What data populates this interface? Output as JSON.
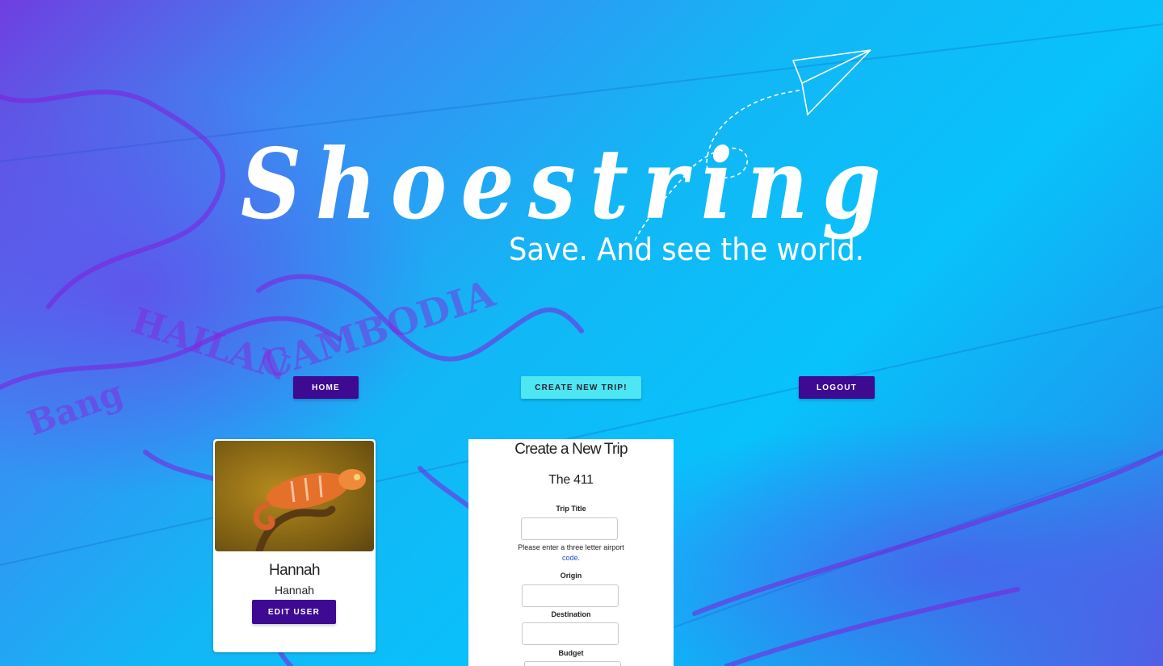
{
  "brand": {
    "name": "Shoestring",
    "tagline": "Save. And see the world."
  },
  "nav": {
    "home": "HOME",
    "create_trip": "CREATE NEW TRIP!",
    "logout": "LOGOUT"
  },
  "user_card": {
    "display_name": "Hannah",
    "username": "Hannah",
    "edit_label": "EDIT USER",
    "photo_subject": "chameleon"
  },
  "trip_form": {
    "title": "Create a New Trip",
    "section": "The 411",
    "fields": {
      "trip_title": {
        "label": "Trip Title",
        "value": ""
      },
      "origin": {
        "label": "Origin",
        "value": ""
      },
      "destination": {
        "label": "Destination",
        "value": ""
      },
      "budget": {
        "label": "Budget",
        "value": ""
      }
    },
    "hint_text": "Please enter a three letter airport",
    "hint_link": "code",
    "hint_end": "."
  },
  "colors": {
    "primary_button": "#3d0a91",
    "accent_button": "#4de6f2",
    "background": "#08c2fb"
  }
}
